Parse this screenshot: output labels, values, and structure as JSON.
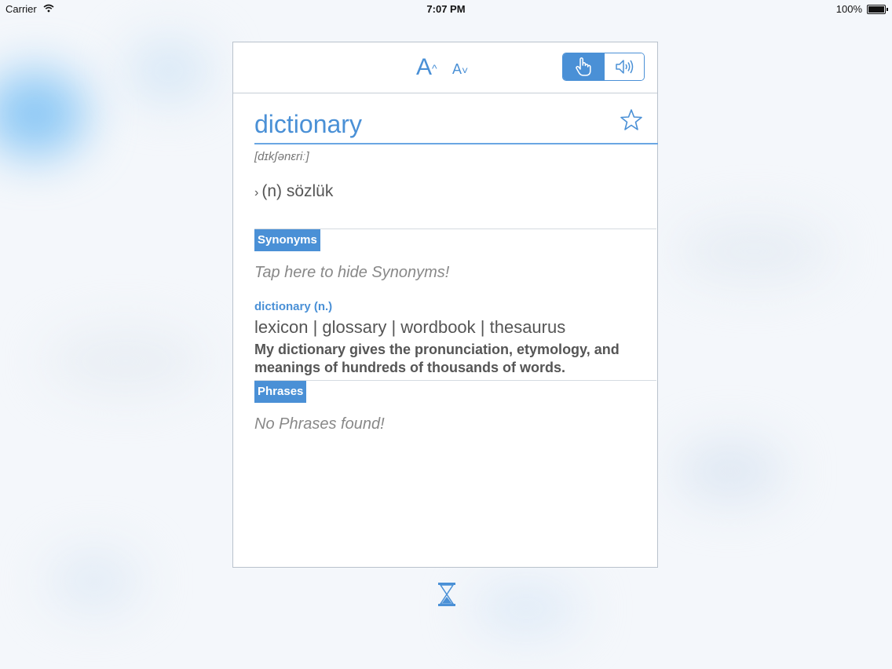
{
  "status_bar": {
    "carrier": "Carrier",
    "time": "7:07 PM",
    "battery": "100%"
  },
  "toolbar": {
    "font_increase_label": "A",
    "font_decrease_label": "A",
    "touch_mode_icon": "hand-pointer-icon",
    "speaker_mode_icon": "speaker-icon",
    "active_mode": "touch"
  },
  "entry": {
    "word": "dictionary",
    "favorite_icon": "star-icon",
    "phonetic": "[dɪkʃənɛriː]",
    "translation": "(n) sözlük"
  },
  "synonyms": {
    "label": "Synonyms",
    "hint": "Tap here to hide Synonyms!",
    "heading": "dictionary (n.)",
    "list": "lexicon | glossary | wordbook | thesaurus",
    "example": "My dictionary gives the pronunciation, etymology, and meanings of hundreds of thousands of words."
  },
  "phrases": {
    "label": "Phrases",
    "empty_text": "No Phrases found!"
  },
  "colors": {
    "accent": "#4a90d6",
    "text": "#555555",
    "hint": "#888888"
  }
}
